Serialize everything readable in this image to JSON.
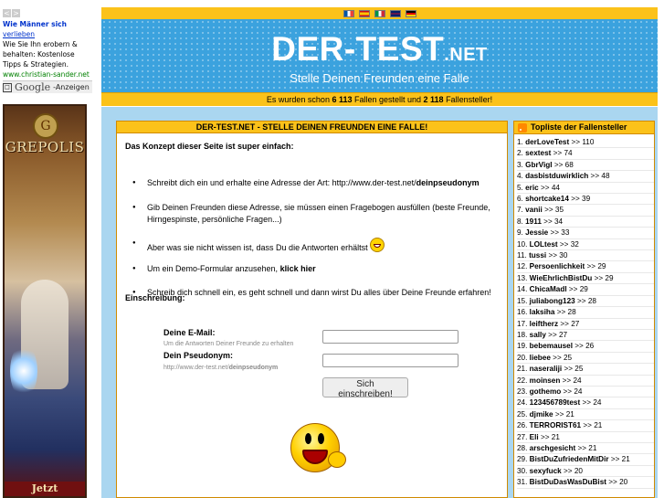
{
  "ad": {
    "nav_prev": "<",
    "nav_next": ">",
    "title": "Wie Männer sich",
    "link": "verlieben",
    "body": "Wie Sie Ihn erobern & behalten: Kostenlose Tipps & Strategien.",
    "url": "www.christian-sander.net",
    "google": "Google",
    "anzeigen": "-Anzeigen"
  },
  "banner": {
    "logo": "GREPOLIS",
    "crest": "G",
    "cta": "Jetzt"
  },
  "header": {
    "flags": [
      {
        "name": "french-flag-icon",
        "colors": [
          "#0055a4",
          "#ffffff",
          "#ef4135"
        ]
      },
      {
        "name": "spanish-flag-icon",
        "colors": [
          "#c60b1e",
          "#ffc400",
          "#c60b1e"
        ]
      },
      {
        "name": "italian-flag-icon",
        "colors": [
          "#009246",
          "#ffffff",
          "#ce2b37"
        ]
      },
      {
        "name": "british-flag-icon",
        "colors": [
          "#012169",
          "#c8102e",
          "#012169"
        ]
      },
      {
        "name": "german-flag-icon",
        "colors": [
          "#000000",
          "#dd0000",
          "#ffce00"
        ]
      }
    ],
    "title_main": "DER-TEST",
    "title_ext": ".NET",
    "subtitle": "Stelle Deinen Freunden eine Falle",
    "stats_pre": "Es wurden schon ",
    "stats_traps": "6 113",
    "stats_mid": " Fallen gestellt und ",
    "stats_setters": "2 118",
    "stats_post": " Fallensteller!"
  },
  "content": {
    "heading": "DER-TEST.NET - STELLE DEINEN FREUNDEN EINE FALLE!",
    "intro": "Das Konzept dieser Seite ist super einfach:",
    "bullets": {
      "b1_text": "Schreibt dich ein und erhalte eine Adresse der Art: http://www.der-test.net/",
      "b1_bold": "deinpseudonym",
      "b2_text": "Gib Deinen Freunden diese Adresse, sie müssen einen Fragebogen ausfüllen (beste Freunde, Hirngespinste, persönliche Fragen...)",
      "b3_text": "Aber was sie nicht wissen ist, dass Du die Antworten erhältst",
      "b4_text": "Um ein Demo-Formular anzusehen, ",
      "b4_bold": "klick hier",
      "b5_text": "Schreib dich schnell ein, es geht schnell und dann wirst Du alles über Deine Freunde erfahren!"
    },
    "registration": "Einschreibung:",
    "email_label": "Deine E-Mail:",
    "email_hint": "Um die Antworten Deiner Freunde zu erhalten",
    "pseudo_label": "Dein Pseudonym:",
    "pseudo_hint_pre": "http://www.der-test.net/",
    "pseudo_hint_bold": "deinpseudonym",
    "submit_label": "Sich einschreiben!"
  },
  "toplist": {
    "heading": "Topliste der Fallensteller",
    "entries": [
      {
        "rank": "1.",
        "name": "derLoveTest",
        "score": " >> 110"
      },
      {
        "rank": "2.",
        "name": "sextest",
        "score": " >> 74"
      },
      {
        "rank": "3.",
        "name": "GbrVigl",
        "score": " >> 68"
      },
      {
        "rank": "4.",
        "name": "dasbistduwirklich",
        "score": " >> 48"
      },
      {
        "rank": "5.",
        "name": "eric",
        "score": " >> 44"
      },
      {
        "rank": "6.",
        "name": "shortcake14",
        "score": " >> 39"
      },
      {
        "rank": "7.",
        "name": "vanii",
        "score": " >> 35"
      },
      {
        "rank": "8.",
        "name": "1911",
        "score": " >> 34"
      },
      {
        "rank": "9.",
        "name": "Jessie",
        "score": " >> 33"
      },
      {
        "rank": "10.",
        "name": "LOLtest",
        "score": " >> 32"
      },
      {
        "rank": "11.",
        "name": "tussi",
        "score": " >> 30"
      },
      {
        "rank": "12.",
        "name": "Persoenlichkeit",
        "score": " >> 29"
      },
      {
        "rank": "13.",
        "name": "WieEhrlichBistDu",
        "score": " >> 29"
      },
      {
        "rank": "14.",
        "name": "ChicaMadl",
        "score": " >> 29"
      },
      {
        "rank": "15.",
        "name": "juliabong123",
        "score": " >> 28"
      },
      {
        "rank": "16.",
        "name": "laksiha",
        "score": " >> 28"
      },
      {
        "rank": "17.",
        "name": "leiftherz",
        "score": " >> 27"
      },
      {
        "rank": "18.",
        "name": "sally",
        "score": " >> 27"
      },
      {
        "rank": "19.",
        "name": "bebemausel",
        "score": " >> 26"
      },
      {
        "rank": "20.",
        "name": "liebee",
        "score": " >> 25"
      },
      {
        "rank": "21.",
        "name": "naseraliji",
        "score": " >> 25"
      },
      {
        "rank": "22.",
        "name": "moinsen",
        "score": " >> 24"
      },
      {
        "rank": "23.",
        "name": "gothemo",
        "score": " >> 24"
      },
      {
        "rank": "24.",
        "name": "123456789test",
        "score": " >> 24"
      },
      {
        "rank": "25.",
        "name": "djmike",
        "score": " >> 21"
      },
      {
        "rank": "26.",
        "name": "TERRORIST61",
        "score": " >> 21"
      },
      {
        "rank": "27.",
        "name": "Eli",
        "score": " >> 21"
      },
      {
        "rank": "28.",
        "name": "arschgesicht",
        "score": " >> 21"
      },
      {
        "rank": "29.",
        "name": "BistDuZufriedenMitDir",
        "score": " >> 21"
      },
      {
        "rank": "30.",
        "name": "sexyfuck",
        "score": " >> 20"
      },
      {
        "rank": "31.",
        "name": "BistDuDasWasDuBist",
        "score": " >> 20"
      }
    ]
  }
}
